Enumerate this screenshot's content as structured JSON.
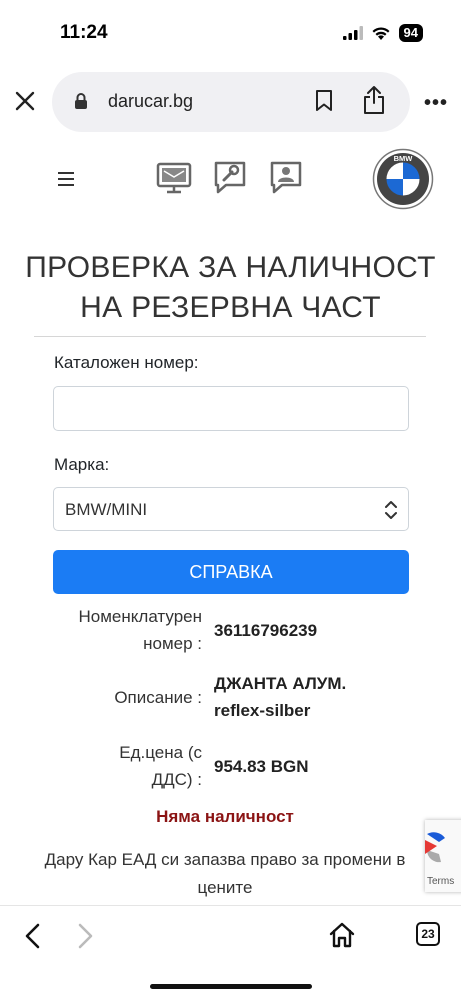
{
  "status_bar": {
    "time": "11:24",
    "battery": "94",
    "icons": [
      "signal-icon",
      "wifi-icon",
      "battery-icon"
    ]
  },
  "browser": {
    "url": "darucar.bg",
    "tab_count": "23",
    "icons": [
      "close-icon",
      "lock-icon",
      "bookmark-icon",
      "share-icon",
      "more-icon",
      "back-icon",
      "forward-icon",
      "home-icon",
      "tabs-icon"
    ]
  },
  "header": {
    "icons": [
      "menu-icon",
      "monitor-icon",
      "wrench-chat-icon",
      "person-chat-icon",
      "bmw-logo"
    ],
    "logo_letters": "BMW"
  },
  "page": {
    "title_line1": "ПРОВЕРКА ЗА НАЛИЧНОСТ",
    "title_line2": "НА РЕЗЕРВНА ЧАСТ"
  },
  "form": {
    "catalog_label": "Каталожен номер:",
    "catalog_value": "",
    "brand_label": "Марка:",
    "brand_selected": "BMW/MINI",
    "submit_label": "СПРАВКА"
  },
  "result": {
    "nomenclature_label_1": "Номенклатурен",
    "nomenclature_label_2": "номер :",
    "nomenclature_value": "36116796239",
    "description_label": "Описание :",
    "description_value_1": "ДЖАНТА АЛУМ.",
    "description_value_2": "reflex-silber",
    "price_label_1": "Ед.цена (с",
    "price_label_2": "ДДС) :",
    "price_value": "954.83 BGN",
    "availability": "Няма наличност",
    "disclaimer": "Дару Кар ЕАД си запазва право за промени в цените"
  },
  "recaptcha": {
    "terms": "Terms"
  },
  "colors": {
    "primary_button": "#1b7cf4",
    "availability": "#8b1414"
  }
}
